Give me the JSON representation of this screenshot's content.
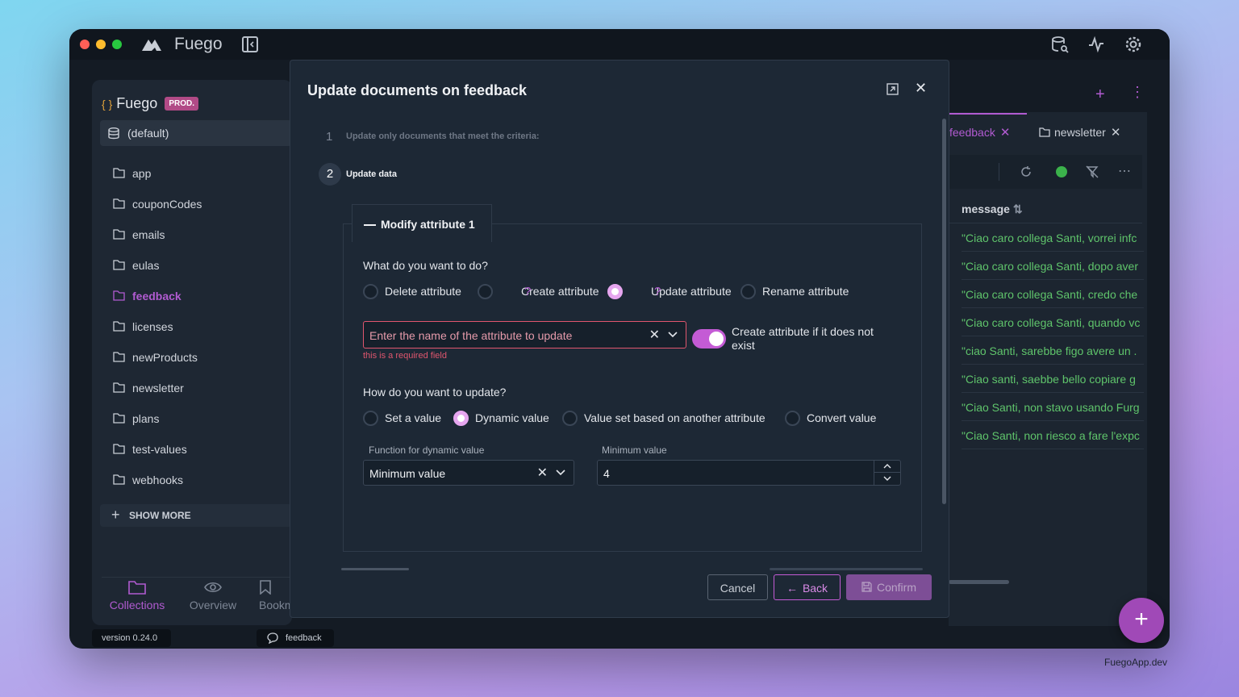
{
  "app": {
    "name": "Fuego",
    "footer_url": "FuegoApp.dev"
  },
  "sidebar": {
    "project_name": "Fuego",
    "env_badge": "PROD.",
    "database": "(default)",
    "collections": [
      "app",
      "couponCodes",
      "emails",
      "eulas",
      "feedback",
      "licenses",
      "newProducts",
      "newsletter",
      "plans",
      "test-values",
      "webhooks"
    ],
    "active_collection": "feedback",
    "show_more": "SHOW MORE",
    "nav": [
      {
        "label": "Collections"
      },
      {
        "label": "Overview"
      },
      {
        "label": "Bookm"
      }
    ],
    "version": "version 0.24.0",
    "feedback_label": "feedback"
  },
  "right_panel": {
    "tabs": [
      {
        "label": "feedback"
      },
      {
        "label": "newsletter"
      }
    ],
    "column_header": "message",
    "rows": [
      "\"Ciao caro collega Santi, vorrei infc",
      "\"Ciao caro collega Santi, dopo aver",
      "\"Ciao caro collega Santi, credo che",
      "\"Ciao caro collega Santi, quando vc",
      "\"ciao Santi, sarebbe figo avere un .",
      "\"Ciao santi, saebbe bello copiare g",
      "\"Ciao Santi, non stavo usando Furg",
      "\"Ciao Santi, non riesco a fare l'expc"
    ]
  },
  "modal": {
    "title": "Update documents on feedback",
    "step1": {
      "number": "1",
      "label": "Update only documents that meet the criteria:"
    },
    "step2": {
      "number": "2",
      "label": "Update data"
    },
    "section_title": "Modify attribute 1",
    "q_what": "What do you want to do?",
    "actions": [
      {
        "label": "Delete attribute",
        "checked": false
      },
      {
        "label": "Create attribute",
        "checked": false,
        "help": "?"
      },
      {
        "label": "Update attribute",
        "checked": true,
        "help": "?"
      },
      {
        "label": "Rename attribute",
        "checked": false
      }
    ],
    "attr_placeholder": "Enter the name of the attribute to update",
    "attr_error": "this is a required field",
    "create_if_missing_label": "Create attribute if it does not exist",
    "create_if_missing_on": true,
    "q_how": "How do you want to update?",
    "modes": [
      {
        "label": "Set a value",
        "checked": false
      },
      {
        "label": "Dynamic value",
        "checked": true
      },
      {
        "label": "Value set based on another attribute",
        "checked": false
      },
      {
        "label": "Convert value",
        "checked": false
      }
    ],
    "function_label": "Function for dynamic value",
    "function_value": "Minimum value",
    "minimum_label": "Minimum value",
    "minimum_value": "4",
    "cancel": "Cancel",
    "back": "Back",
    "confirm": "Confirm"
  },
  "colors": {
    "accent": "#b15bd1",
    "error": "#e0566e",
    "success": "#5fc46b"
  }
}
